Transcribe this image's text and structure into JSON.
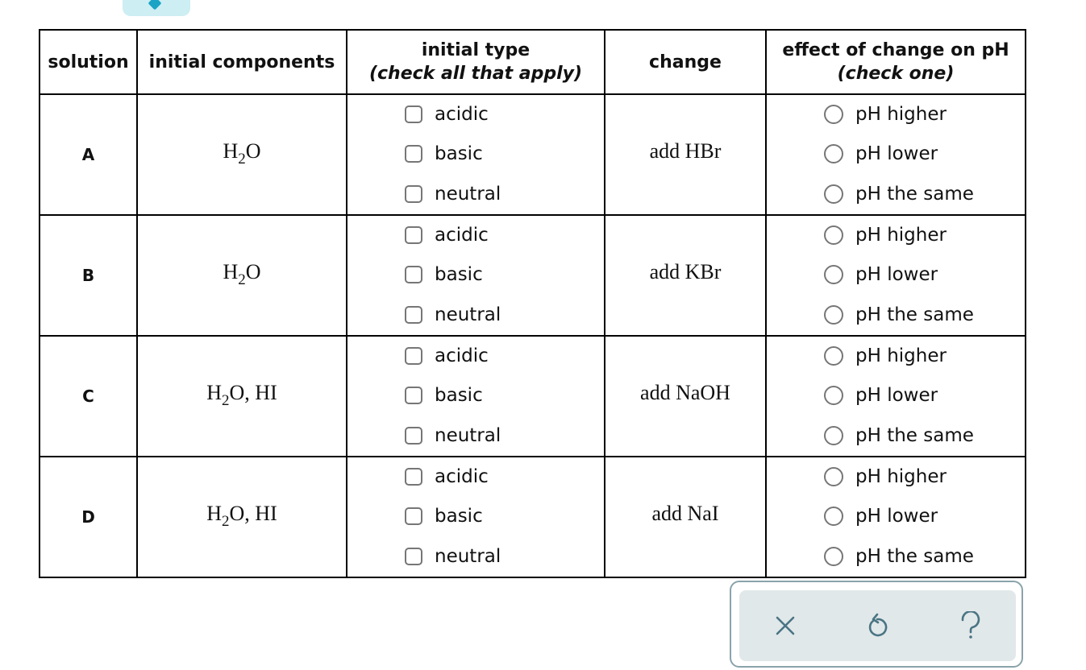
{
  "top_tab": {
    "icon": "chevron-down-icon"
  },
  "table": {
    "headers": {
      "solution": "solution",
      "initial_components": "initial components",
      "initial_type": "initial type",
      "initial_type_sub": "(check all that apply)",
      "change": "change",
      "effect": "effect of change on pH",
      "effect_sub": "(check one)"
    },
    "type_options": [
      "acidic",
      "basic",
      "neutral"
    ],
    "effect_options": [
      "pH higher",
      "pH lower",
      "pH the same"
    ],
    "rows": [
      {
        "solution": "A",
        "components_main": "H",
        "components_sub": "2",
        "components_rest": "O",
        "change": "add HBr",
        "types_checked": [
          false,
          false,
          false
        ],
        "effect_selected": null
      },
      {
        "solution": "B",
        "components_main": "H",
        "components_sub": "2",
        "components_rest": "O",
        "change": "add KBr",
        "types_checked": [
          false,
          false,
          false
        ],
        "effect_selected": null
      },
      {
        "solution": "C",
        "components_main": "H",
        "components_sub": "2",
        "components_rest": "O, HI",
        "change": "add NaOH",
        "types_checked": [
          false,
          false,
          false
        ],
        "effect_selected": null
      },
      {
        "solution": "D",
        "components_main": "H",
        "components_sub": "2",
        "components_rest": "O, HI",
        "change": "add NaI",
        "types_checked": [
          false,
          false,
          false
        ],
        "effect_selected": null
      }
    ]
  },
  "toolbar": {
    "clear_icon": "x-icon",
    "undo_icon": "undo-icon",
    "help_icon": "help-icon",
    "icon_color": "#4a7483"
  }
}
